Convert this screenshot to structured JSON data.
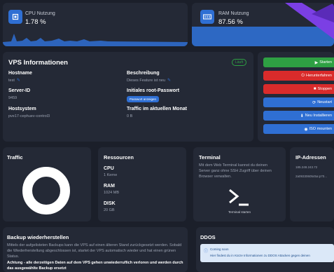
{
  "cpu": {
    "label": "CPU Nutzung",
    "value": "1.78 %"
  },
  "ram": {
    "label": "RAM Nutzung",
    "value": "87.56 %"
  },
  "info": {
    "title": "VPS Informationen",
    "status": "Läuft",
    "hostname_label": "Hostname",
    "hostname_value": "test",
    "desc_label": "Beschreibung",
    "desc_value": "Dieses Feature ist neu",
    "server_id_label": "Server-ID",
    "server_id_value": "9459",
    "root_label": "Initiales root-Passwort",
    "root_button": "Passwort anzeigen",
    "host_label": "Hostsystem",
    "host_value": "pve17-cephuev-control3",
    "traffic_label": "Traffic im aktuellen Monat",
    "traffic_value": "0 B"
  },
  "actions": [
    {
      "label": "Starten",
      "icon": "▶",
      "color": "#2ea043"
    },
    {
      "label": "Herunterfahren",
      "icon": "⏻",
      "color": "#d92b2b"
    },
    {
      "label": "Stoppen",
      "icon": "■",
      "color": "#d92b2b"
    },
    {
      "label": "Neustart",
      "icon": "⟳",
      "color": "#2f6fd3"
    },
    {
      "label": "Neu Installieren",
      "icon": "⬇",
      "color": "#2f6fd3"
    },
    {
      "label": "ISO mounten",
      "icon": "◉",
      "color": "#2f6fd3"
    }
  ],
  "traffic": {
    "title": "Traffic"
  },
  "resources": {
    "title": "Ressourcen",
    "cpu_label": "CPU",
    "cpu_value": "1 Kerne",
    "ram_label": "RAM",
    "ram_value": "1024 MB",
    "disk_label": "DISK",
    "disk_value": "20 GB"
  },
  "terminal": {
    "title": "Terminal",
    "desc": "Mit dem Web Terminal kannst du deinen Server ganz ohne SSH Zugriff über deinen Browser verwalten.",
    "button": "Terminal starten"
  },
  "ip": {
    "title": "IP-Adressen",
    "ipv4": "185.248.243.72",
    "ipv6": "2a0933060545a:p70..."
  },
  "backup": {
    "title": "Backup wiederherstellen",
    "desc": "Mittels der aufgelisteten Backups kann die VPS auf einen älteren Stand zurückgesetzt werden. Sobald die Wiederherstellung abgeschlossen ist, startet der VPS automatisch wieder und hat einen grünen Status.",
    "warning": "Achtung - alle derzeitigen Daten auf dem VPS gehen unwiederruflich verloren und werden durch das ausgewählte Backup ersetzt"
  },
  "ddos": {
    "title": "DDOS",
    "alert_title": "Coming soon",
    "alert_text": "Hier findest du in Kürze Informationen zu DDOS Attacken gegen deinen"
  }
}
